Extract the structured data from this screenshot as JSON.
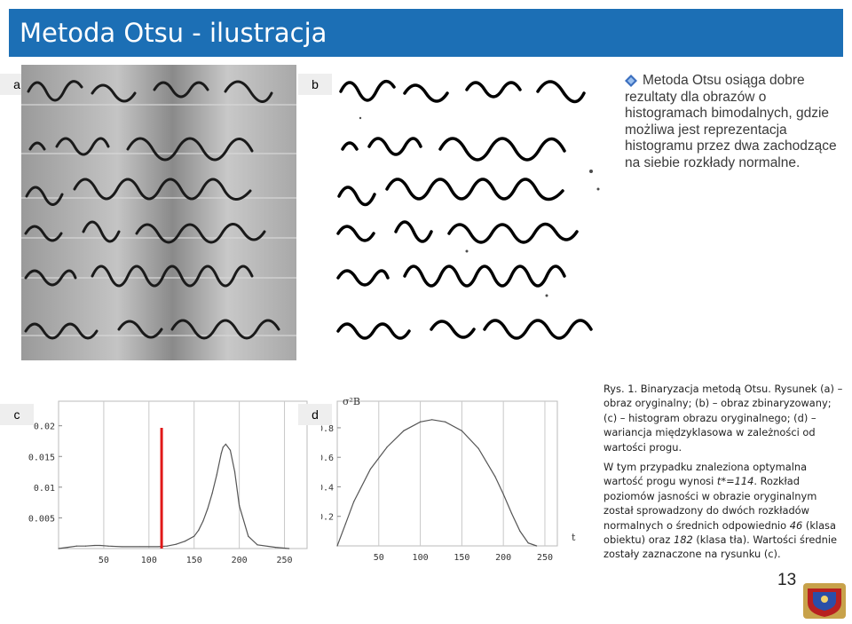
{
  "slide": {
    "title": "Metoda Otsu - ilustracja",
    "page_number": "13",
    "colors": {
      "title_bar": "#1c6fb5",
      "title_text": "#ffffff",
      "threshold_line": "#e01818"
    }
  },
  "panels": {
    "a": {
      "label": "a"
    },
    "b": {
      "label": "b"
    },
    "c": {
      "label": "c"
    },
    "d": {
      "label": "d"
    }
  },
  "bullet": {
    "icon": "diamond-bullet-icon",
    "text": "Metoda Otsu osiąga dobre rezultaty dla obrazów o histogramach bimodalnych, gdzie możliwa jest reprezentacja histogramu przez dwa zachodzące na siebie rozkłady normalne."
  },
  "caption": {
    "paragraph1": "Rys. 1. Binaryzacja metodą Otsu. Rysunek (a) – obraz oryginalny; (b) – obraz zbinaryzowany; (c) – histogram obrazu oryginalnego; (d) – wariancja międzyklasowa w zależności od wartości progu.",
    "p2_a": "W tym przypadku znaleziona optymalna wartość progu wynosi ",
    "p2_b": "t*=114",
    "p2_c": ". Rozkład poziomów jasności w obrazie oryginalnym został sprowadzony do dwóch rozkładów normalnych o średnich odpowiednio ",
    "p2_d": "46",
    "p2_e": " (klasa obiektu) oraz ",
    "p2_f": "182",
    "p2_g": " (klasa tła). Wartości średnie zostały zaznaczone na rysunku (c)."
  },
  "chart_data": [
    {
      "type": "line",
      "panel": "c",
      "title": "",
      "xlabel": "",
      "ylabel": "",
      "x_ticks": [
        50,
        100,
        150,
        200,
        250
      ],
      "y_ticks": [
        0.005,
        0.01,
        0.015,
        0.02
      ],
      "y_tick_labels": [
        "0.005",
        "0.01",
        "0.015",
        "0.02"
      ],
      "xlim": [
        0,
        275
      ],
      "ylim": [
        0,
        0.024
      ],
      "gridlines": "vertical at x ticks",
      "threshold_line": 114,
      "x": [
        0,
        10,
        20,
        30,
        40,
        46,
        55,
        70,
        90,
        110,
        120,
        130,
        140,
        150,
        155,
        160,
        165,
        170,
        175,
        180,
        182,
        185,
        190,
        195,
        200,
        210,
        220,
        240,
        255
      ],
      "values": [
        0,
        0.0002,
        0.0004,
        0.0004,
        0.0005,
        0.0005,
        0.0004,
        0.0003,
        0.0003,
        0.0003,
        0.0004,
        0.0007,
        0.0012,
        0.002,
        0.003,
        0.0045,
        0.0065,
        0.009,
        0.012,
        0.0155,
        0.0165,
        0.017,
        0.016,
        0.0125,
        0.007,
        0.002,
        0.0006,
        0.0002,
        0
      ]
    },
    {
      "type": "line",
      "panel": "d",
      "title": "",
      "xlabel": "t",
      "ylabel": "σ²B",
      "x_ticks": [
        50,
        100,
        150,
        200,
        250
      ],
      "y_ticks": [
        0.2,
        0.4,
        0.6,
        0.8
      ],
      "y_tick_labels": [
        "0.2",
        "0.4",
        "0.6",
        "0.8"
      ],
      "xlim": [
        0,
        265
      ],
      "ylim": [
        0,
        0.98
      ],
      "gridlines": "vertical at x ticks",
      "x": [
        0,
        10,
        20,
        40,
        60,
        80,
        100,
        114,
        130,
        150,
        170,
        190,
        200,
        210,
        220,
        230,
        240
      ],
      "values": [
        0,
        0.15,
        0.3,
        0.52,
        0.67,
        0.78,
        0.84,
        0.855,
        0.84,
        0.78,
        0.66,
        0.47,
        0.35,
        0.22,
        0.1,
        0.02,
        0
      ]
    }
  ]
}
